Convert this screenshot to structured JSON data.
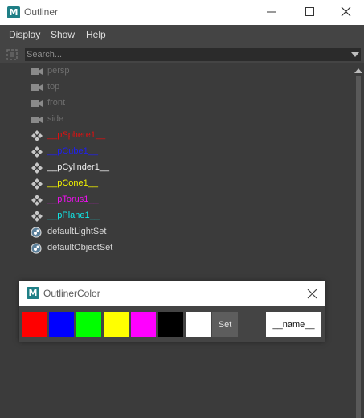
{
  "window": {
    "title": "Outliner"
  },
  "menu": {
    "display": "Display",
    "show": "Show",
    "help": "Help"
  },
  "search": {
    "placeholder": "Search..."
  },
  "tree": [
    {
      "label": "persp",
      "icon": "camera-icon",
      "color": "#6f6f6f"
    },
    {
      "label": "top",
      "icon": "camera-icon",
      "color": "#6f6f6f"
    },
    {
      "label": "front",
      "icon": "camera-icon",
      "color": "#6f6f6f"
    },
    {
      "label": "side",
      "icon": "camera-icon",
      "color": "#6f6f6f"
    },
    {
      "label": "__pSphere1__",
      "icon": "transform-icon",
      "color": "#e01010"
    },
    {
      "label": "__pCube1__",
      "icon": "transform-icon",
      "color": "#2020ee"
    },
    {
      "label": "__pCylinder1__",
      "icon": "transform-icon",
      "color": "#f0f0f0"
    },
    {
      "label": "__pCone1__",
      "icon": "transform-icon",
      "color": "#f0f000"
    },
    {
      "label": "__pTorus1__",
      "icon": "transform-icon",
      "color": "#ee10ee"
    },
    {
      "label": "__pPlane1__",
      "icon": "transform-icon",
      "color": "#10e8e8"
    },
    {
      "label": "defaultLightSet",
      "icon": "set-icon",
      "color": "#d6d6d6"
    },
    {
      "label": "defaultObjectSet",
      "icon": "set-icon",
      "color": "#d6d6d6"
    }
  ],
  "outliner_color": {
    "title": "OutlinerColor",
    "swatches": [
      "#ff0000",
      "#0000ff",
      "#00ff00",
      "#ffff00",
      "#ff00ff",
      "#000000",
      "#ffffff"
    ],
    "set_label": "Set",
    "name_label": "__name__"
  }
}
